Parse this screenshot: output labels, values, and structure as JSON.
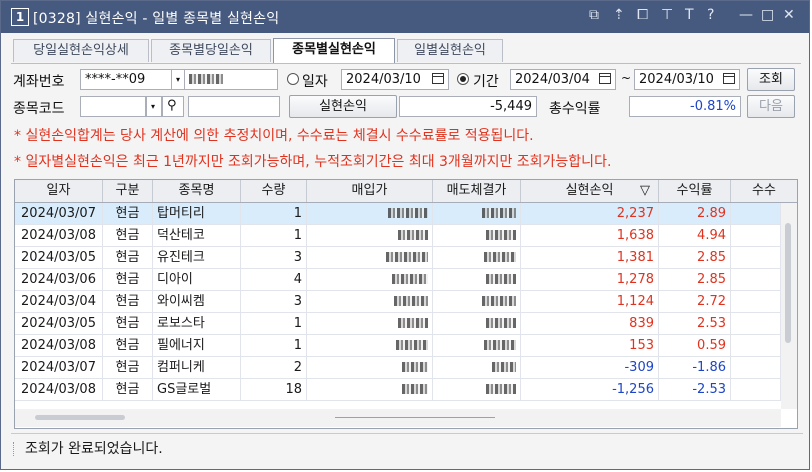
{
  "window": {
    "number": "1",
    "title": "[0328] 실현손익 - 일별 종목별 실현손익",
    "controls": [
      "⧉",
      "⇡",
      "⧠",
      "⊤",
      "T",
      "?",
      "—",
      "□",
      "✕"
    ]
  },
  "tabs": [
    {
      "label": "당일실현손익상세"
    },
    {
      "label": "종목별당일손익"
    },
    {
      "label": "종목별실현손익"
    },
    {
      "label": "일별실현손익"
    }
  ],
  "form": {
    "account_label": "계좌번호",
    "account_value": "****-**09",
    "account_name": "",
    "radio_date_label": "일자",
    "date_value": "2024/03/10",
    "radio_period_label": "기간",
    "period_from": "2024/03/04",
    "tilde": "~",
    "period_to": "2024/03/10",
    "query_button": "조회",
    "stock_code_label": "종목코드",
    "stock_code_value": "",
    "stock_name_value": "",
    "realized_label": "실현손익",
    "realized_value": "-5,449",
    "total_return_label": "총수익률",
    "total_return_value": "-0.81%",
    "next_button": "다음"
  },
  "notices": [
    "* 실현손익합계는 당사 계산에 의한 추정치이며, 수수료는 체결시 수수료률로 적용됩니다.",
    "* 일자별실현손익은 최근 1년까지만 조회가능하며, 누적조회기간은 최대 3개월까지만 조회가능합니다."
  ],
  "table": {
    "headers": [
      "일자",
      "구분",
      "종목명",
      "수량",
      "매입가",
      "매도체결가",
      "실현손익",
      "수익률",
      "수수"
    ],
    "sort_indicator": "▽",
    "rows": [
      {
        "date": "2024/03/07",
        "type": "현금",
        "name": "탑머티리",
        "qty": "1",
        "pnl": "2,237",
        "ret": "2.89",
        "sign": "pos"
      },
      {
        "date": "2024/03/08",
        "type": "현금",
        "name": "덕산테코",
        "qty": "1",
        "pnl": "1,638",
        "ret": "4.94",
        "sign": "pos"
      },
      {
        "date": "2024/03/05",
        "type": "현금",
        "name": "유진테크",
        "qty": "3",
        "pnl": "1,381",
        "ret": "2.85",
        "sign": "pos"
      },
      {
        "date": "2024/03/06",
        "type": "현금",
        "name": "디아이",
        "qty": "4",
        "pnl": "1,278",
        "ret": "2.85",
        "sign": "pos"
      },
      {
        "date": "2024/03/04",
        "type": "현금",
        "name": "와이씨켐",
        "qty": "3",
        "pnl": "1,124",
        "ret": "2.72",
        "sign": "pos"
      },
      {
        "date": "2024/03/05",
        "type": "현금",
        "name": "로보스타",
        "qty": "1",
        "pnl": "839",
        "ret": "2.53",
        "sign": "pos"
      },
      {
        "date": "2024/03/08",
        "type": "현금",
        "name": "필에너지",
        "qty": "1",
        "pnl": "153",
        "ret": "0.59",
        "sign": "pos"
      },
      {
        "date": "2024/03/07",
        "type": "현금",
        "name": "컴퍼니케",
        "qty": "2",
        "pnl": "-309",
        "ret": "-1.86",
        "sign": "neg"
      },
      {
        "date": "2024/03/08",
        "type": "현금",
        "name": "GS글로벌",
        "qty": "18",
        "pnl": "-1,256",
        "ret": "-2.53",
        "sign": "neg"
      }
    ]
  },
  "status": {
    "message": "조회가 완료되었습니다."
  },
  "colors": {
    "title_bar": "#46597e",
    "notice_red": "#e0331f",
    "negative_blue": "#1d45c8",
    "selected_row": "#d9ecfb"
  }
}
